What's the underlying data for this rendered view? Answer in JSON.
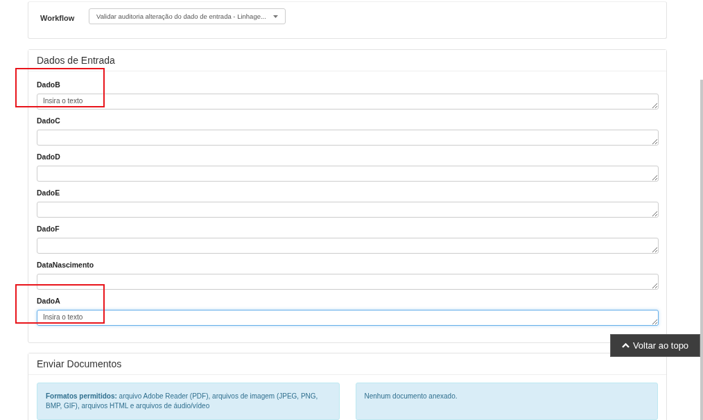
{
  "workflow": {
    "label": "Workflow",
    "value": "Validar auditoria alteração do dado de entrada - Linhage..."
  },
  "input_panel": {
    "title": "Dados de Entrada",
    "fields": [
      {
        "label": "DadoB",
        "placeholder": "Insira o texto",
        "focused": false,
        "highlighted": true
      },
      {
        "label": "DadoC",
        "focused": false,
        "highlighted": false
      },
      {
        "label": "DadoD",
        "focused": false,
        "highlighted": false
      },
      {
        "label": "DadoE",
        "focused": false,
        "highlighted": false
      },
      {
        "label": "DadoF",
        "focused": false,
        "highlighted": false
      },
      {
        "label": "DataNascimento",
        "focused": false,
        "highlighted": false
      },
      {
        "label": "DadoA",
        "placeholder": "Insira o texto",
        "focused": true,
        "highlighted": true
      }
    ]
  },
  "documents_panel": {
    "title": "Enviar Documentos",
    "formats_note": "**Formatos permitidos:** arquivo Adobe Reader (PDF), arquivos de imagem (JPEG, PNG, BMP, GIF), arquivos HTML e arquivos de áudio/vídeo",
    "attachments_note": "Nenhum documento anexado."
  },
  "back_to_top": {
    "label": "Voltar ao topo"
  }
}
